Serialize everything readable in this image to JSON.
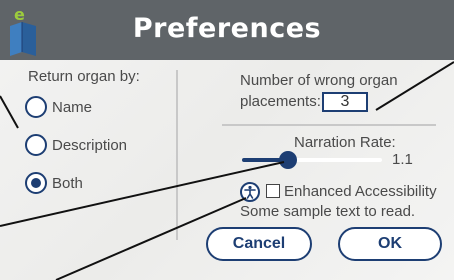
{
  "dialog": {
    "title": "Preferences"
  },
  "organ_panel": {
    "heading": "Return organ by:",
    "options": [
      {
        "label": "Name",
        "checked": false
      },
      {
        "label": "Description",
        "checked": false
      },
      {
        "label": "Both",
        "checked": true
      }
    ]
  },
  "wrong_placements": {
    "label_line1": "Number of wrong organ",
    "label_line2": "placements:",
    "value": "3"
  },
  "narration": {
    "label": "Narration Rate:",
    "value_text": "1.1",
    "slider_fraction": 0.33
  },
  "accessibility": {
    "checkbox_label": "Enhanced Accessibility",
    "checked": false,
    "icon": "accessibility-icon"
  },
  "sample_text": "Some sample text to read.",
  "buttons": {
    "cancel": "Cancel",
    "ok": "OK"
  },
  "colors": {
    "titlebar": "#5f6468",
    "accent": "#1d3e73",
    "panel": "#f0f0ef",
    "text": "#4a4a4a"
  }
}
